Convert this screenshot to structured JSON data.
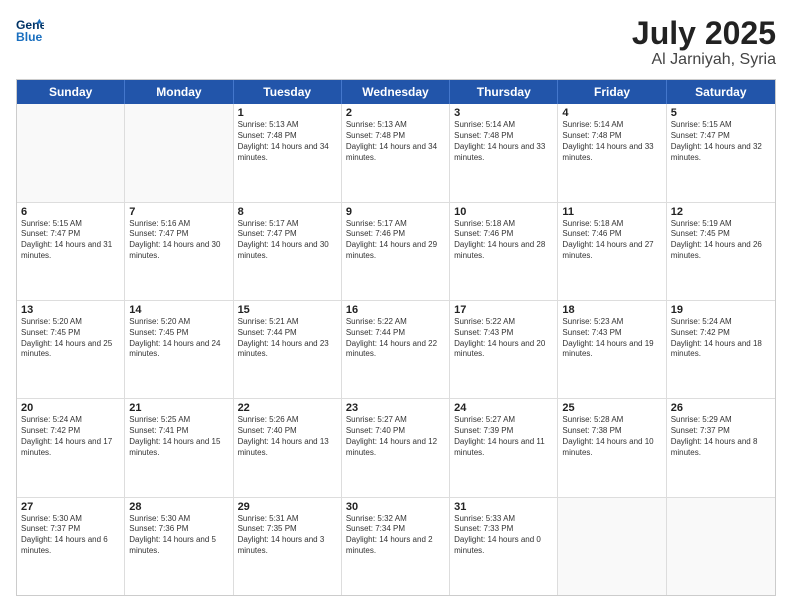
{
  "header": {
    "logo_line1": "General",
    "logo_line2": "Blue",
    "month": "July 2025",
    "location": "Al Jarniyah, Syria"
  },
  "days_of_week": [
    "Sunday",
    "Monday",
    "Tuesday",
    "Wednesday",
    "Thursday",
    "Friday",
    "Saturday"
  ],
  "weeks": [
    [
      {
        "day": "",
        "text": ""
      },
      {
        "day": "",
        "text": ""
      },
      {
        "day": "1",
        "text": "Sunrise: 5:13 AM\nSunset: 7:48 PM\nDaylight: 14 hours and 34 minutes."
      },
      {
        "day": "2",
        "text": "Sunrise: 5:13 AM\nSunset: 7:48 PM\nDaylight: 14 hours and 34 minutes."
      },
      {
        "day": "3",
        "text": "Sunrise: 5:14 AM\nSunset: 7:48 PM\nDaylight: 14 hours and 33 minutes."
      },
      {
        "day": "4",
        "text": "Sunrise: 5:14 AM\nSunset: 7:48 PM\nDaylight: 14 hours and 33 minutes."
      },
      {
        "day": "5",
        "text": "Sunrise: 5:15 AM\nSunset: 7:47 PM\nDaylight: 14 hours and 32 minutes."
      }
    ],
    [
      {
        "day": "6",
        "text": "Sunrise: 5:15 AM\nSunset: 7:47 PM\nDaylight: 14 hours and 31 minutes."
      },
      {
        "day": "7",
        "text": "Sunrise: 5:16 AM\nSunset: 7:47 PM\nDaylight: 14 hours and 30 minutes."
      },
      {
        "day": "8",
        "text": "Sunrise: 5:17 AM\nSunset: 7:47 PM\nDaylight: 14 hours and 30 minutes."
      },
      {
        "day": "9",
        "text": "Sunrise: 5:17 AM\nSunset: 7:46 PM\nDaylight: 14 hours and 29 minutes."
      },
      {
        "day": "10",
        "text": "Sunrise: 5:18 AM\nSunset: 7:46 PM\nDaylight: 14 hours and 28 minutes."
      },
      {
        "day": "11",
        "text": "Sunrise: 5:18 AM\nSunset: 7:46 PM\nDaylight: 14 hours and 27 minutes."
      },
      {
        "day": "12",
        "text": "Sunrise: 5:19 AM\nSunset: 7:45 PM\nDaylight: 14 hours and 26 minutes."
      }
    ],
    [
      {
        "day": "13",
        "text": "Sunrise: 5:20 AM\nSunset: 7:45 PM\nDaylight: 14 hours and 25 minutes."
      },
      {
        "day": "14",
        "text": "Sunrise: 5:20 AM\nSunset: 7:45 PM\nDaylight: 14 hours and 24 minutes."
      },
      {
        "day": "15",
        "text": "Sunrise: 5:21 AM\nSunset: 7:44 PM\nDaylight: 14 hours and 23 minutes."
      },
      {
        "day": "16",
        "text": "Sunrise: 5:22 AM\nSunset: 7:44 PM\nDaylight: 14 hours and 22 minutes."
      },
      {
        "day": "17",
        "text": "Sunrise: 5:22 AM\nSunset: 7:43 PM\nDaylight: 14 hours and 20 minutes."
      },
      {
        "day": "18",
        "text": "Sunrise: 5:23 AM\nSunset: 7:43 PM\nDaylight: 14 hours and 19 minutes."
      },
      {
        "day": "19",
        "text": "Sunrise: 5:24 AM\nSunset: 7:42 PM\nDaylight: 14 hours and 18 minutes."
      }
    ],
    [
      {
        "day": "20",
        "text": "Sunrise: 5:24 AM\nSunset: 7:42 PM\nDaylight: 14 hours and 17 minutes."
      },
      {
        "day": "21",
        "text": "Sunrise: 5:25 AM\nSunset: 7:41 PM\nDaylight: 14 hours and 15 minutes."
      },
      {
        "day": "22",
        "text": "Sunrise: 5:26 AM\nSunset: 7:40 PM\nDaylight: 14 hours and 13 minutes."
      },
      {
        "day": "23",
        "text": "Sunrise: 5:27 AM\nSunset: 7:40 PM\nDaylight: 14 hours and 12 minutes."
      },
      {
        "day": "24",
        "text": "Sunrise: 5:27 AM\nSunset: 7:39 PM\nDaylight: 14 hours and 11 minutes."
      },
      {
        "day": "25",
        "text": "Sunrise: 5:28 AM\nSunset: 7:38 PM\nDaylight: 14 hours and 10 minutes."
      },
      {
        "day": "26",
        "text": "Sunrise: 5:29 AM\nSunset: 7:37 PM\nDaylight: 14 hours and 8 minutes."
      }
    ],
    [
      {
        "day": "27",
        "text": "Sunrise: 5:30 AM\nSunset: 7:37 PM\nDaylight: 14 hours and 6 minutes."
      },
      {
        "day": "28",
        "text": "Sunrise: 5:30 AM\nSunset: 7:36 PM\nDaylight: 14 hours and 5 minutes."
      },
      {
        "day": "29",
        "text": "Sunrise: 5:31 AM\nSunset: 7:35 PM\nDaylight: 14 hours and 3 minutes."
      },
      {
        "day": "30",
        "text": "Sunrise: 5:32 AM\nSunset: 7:34 PM\nDaylight: 14 hours and 2 minutes."
      },
      {
        "day": "31",
        "text": "Sunrise: 5:33 AM\nSunset: 7:33 PM\nDaylight: 14 hours and 0 minutes."
      },
      {
        "day": "",
        "text": ""
      },
      {
        "day": "",
        "text": ""
      }
    ]
  ]
}
